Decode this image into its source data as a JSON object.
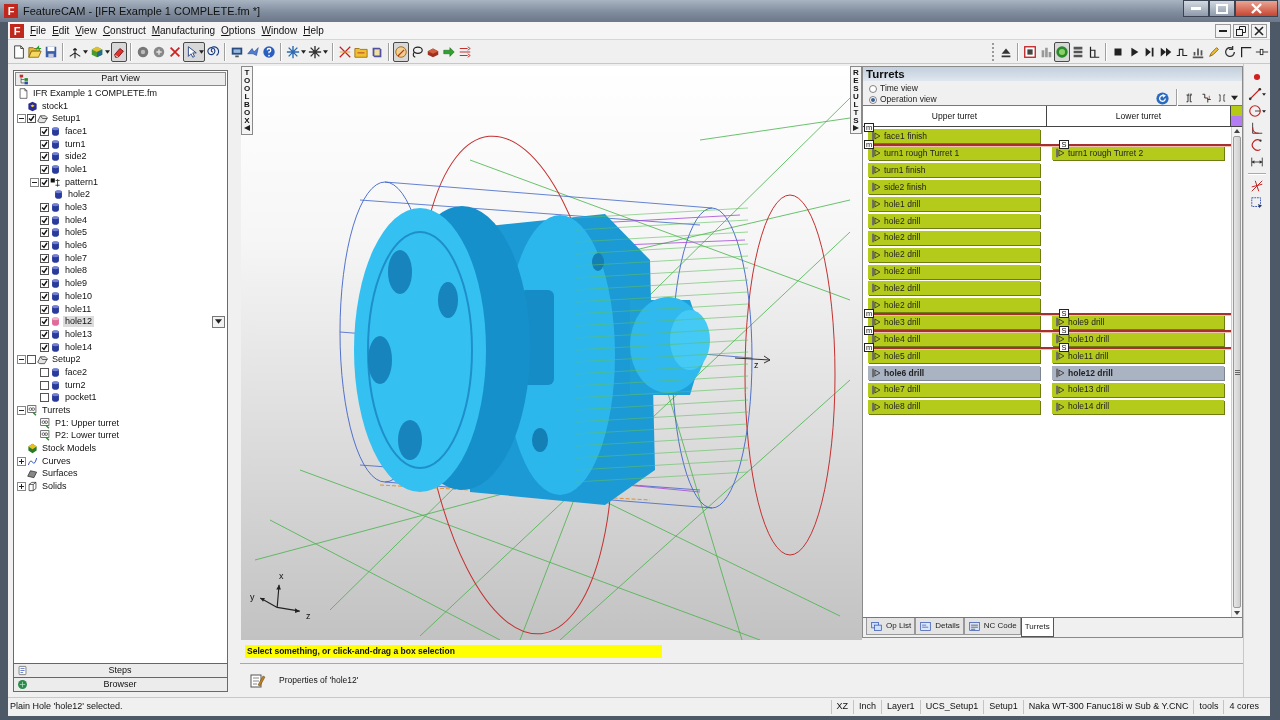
{
  "window": {
    "logo": "F",
    "title": "FeatureCAM - [IFR Example 1 COMPLETE.fm *]"
  },
  "menu_logo": "F",
  "menu": [
    "File",
    "Edit",
    "View",
    "Construct",
    "Manufacturing",
    "Options",
    "Window",
    "Help"
  ],
  "toolbar": {
    "left_groups": [
      [
        {
          "pressed": false
        },
        {
          "pressed": false
        },
        {
          "pressed": false
        }
      ],
      [
        {
          "pressed": false
        },
        {
          "pressed": false
        },
        {
          "pressed": true
        }
      ],
      [
        {
          "pressed": false
        },
        {
          "pressed": false
        },
        {
          "pressed": false
        },
        {
          "pressed": true
        },
        {
          "pressed": false
        }
      ],
      [
        {
          "pressed": false
        },
        {
          "pressed": false
        },
        {
          "pressed": false
        }
      ],
      [
        {
          "pressed": false
        },
        {
          "pressed": false
        }
      ],
      [
        {
          "pressed": false
        },
        {
          "pressed": false
        },
        {
          "pressed": false
        }
      ],
      [
        {
          "pressed": true
        },
        {
          "pressed": false
        },
        {
          "pressed": false
        },
        {
          "pressed": false
        },
        {
          "pressed": false
        }
      ]
    ],
    "right_groups": [
      [
        {
          "pressed": false
        }
      ],
      [
        {
          "pressed": false
        },
        {
          "pressed": false
        },
        {
          "pressed": true
        },
        {
          "pressed": false
        },
        {
          "pressed": false
        }
      ],
      [
        {
          "pressed": false
        },
        {
          "pressed": false
        },
        {
          "pressed": false
        },
        {
          "pressed": false
        },
        {
          "pressed": false
        },
        {
          "pressed": false
        },
        {
          "pressed": false
        },
        {
          "pressed": false
        },
        {
          "pressed": false
        },
        {
          "pressed": false
        }
      ]
    ]
  },
  "part_view": {
    "title": "Part View",
    "tree": [
      {
        "label": "IFR Example 1 COMPLETE.fm",
        "kind": "document",
        "selected": false,
        "children": [
          {
            "label": "stock1",
            "kind": "stock",
            "selected": false
          },
          {
            "label": "Setup1",
            "kind": "setup",
            "checked": true,
            "expanded": true,
            "selected": false,
            "children": [
              {
                "label": "face1",
                "kind": "feature",
                "checked": true,
                "selected": false
              },
              {
                "label": "turn1",
                "kind": "feature",
                "checked": true,
                "selected": false
              },
              {
                "label": "side2",
                "kind": "feature",
                "checked": true,
                "selected": false
              },
              {
                "label": "hole1",
                "kind": "feature",
                "checked": true,
                "selected": false
              },
              {
                "label": "pattern1",
                "kind": "pattern",
                "checked": true,
                "expanded": true,
                "selected": false,
                "children": [
                  {
                    "label": "hole2",
                    "kind": "feature",
                    "selected": false
                  }
                ]
              },
              {
                "label": "hole3",
                "kind": "feature",
                "checked": true,
                "selected": false
              },
              {
                "label": "hole4",
                "kind": "feature",
                "checked": true,
                "selected": false
              },
              {
                "label": "hole5",
                "kind": "feature",
                "checked": true,
                "selected": false
              },
              {
                "label": "hole6",
                "kind": "feature",
                "checked": true,
                "selected": false
              },
              {
                "label": "hole7",
                "kind": "feature",
                "checked": true,
                "selected": false
              },
              {
                "label": "hole8",
                "kind": "feature",
                "checked": true,
                "selected": false
              },
              {
                "label": "hole9",
                "kind": "feature",
                "checked": true,
                "selected": false
              },
              {
                "label": "hole10",
                "kind": "feature",
                "checked": true,
                "selected": false
              },
              {
                "label": "hole11",
                "kind": "feature",
                "checked": true,
                "selected": false
              },
              {
                "label": "hole12",
                "kind": "feature",
                "checked": true,
                "selected": true
              },
              {
                "label": "hole13",
                "kind": "feature",
                "checked": true,
                "selected": false
              },
              {
                "label": "hole14",
                "kind": "feature",
                "checked": true,
                "selected": false
              }
            ]
          },
          {
            "label": "Setup2",
            "kind": "setup",
            "checked": false,
            "expanded": true,
            "selected": false,
            "children": [
              {
                "label": "face2",
                "kind": "feature",
                "checked": false,
                "selected": false
              },
              {
                "label": "turn2",
                "kind": "feature",
                "checked": false,
                "selected": false
              },
              {
                "label": "pocket1",
                "kind": "feature",
                "checked": false,
                "selected": false
              }
            ]
          },
          {
            "label": "Turrets",
            "kind": "turret",
            "expanded": true,
            "selected": false,
            "children": [
              {
                "label": "P1: Upper turret",
                "kind": "turret",
                "selected": false
              },
              {
                "label": "P2: Lower turret",
                "kind": "turret",
                "selected": false
              }
            ]
          },
          {
            "label": "Stock Models",
            "kind": "stock-models",
            "selected": false
          },
          {
            "label": "Curves",
            "kind": "curves",
            "expanded": false,
            "selected": false
          },
          {
            "label": "Surfaces",
            "kind": "surfaces",
            "selected": false
          },
          {
            "label": "Solids",
            "kind": "solids",
            "expanded": false,
            "selected": false
          }
        ]
      }
    ]
  },
  "left_tabs": [
    {
      "label": "Steps"
    },
    {
      "label": "Browser"
    }
  ],
  "toolbox": {
    "label": "TOOLBOX"
  },
  "results": {
    "label": "RESULTS"
  },
  "viewport": {
    "axis_labels": [
      "x",
      "y",
      "z"
    ],
    "part_axis_label": "z"
  },
  "turrets": {
    "title": "Turrets",
    "view_options": [
      {
        "label": "Time view",
        "selected": false
      },
      {
        "label": "Operation view",
        "selected": true
      }
    ],
    "columns": [
      "Upper turret",
      "Lower turret"
    ],
    "swatches": [
      {
        "color": "#b4ca14"
      },
      {
        "color": "#b47cf2"
      }
    ],
    "rows": [
      {
        "upper": {
          "label": "face1 finish",
          "selected": false
        },
        "upper_marker": "m",
        "sync_line": false
      },
      {
        "upper": {
          "label": "turn1 rough Turret 1",
          "selected": false
        },
        "lower": {
          "label": "turn1 rough Turret 2",
          "selected": false
        },
        "upper_marker": "m",
        "lower_marker": "S",
        "sync_line": true
      },
      {
        "upper": {
          "label": "turn1 finish",
          "selected": false
        },
        "sync_line": false
      },
      {
        "upper": {
          "label": "side2 finish",
          "selected": false
        },
        "sync_line": false
      },
      {
        "upper": {
          "label": "hole1 drill",
          "selected": false
        },
        "sync_line": false
      },
      {
        "upper": {
          "label": "hole2 drill",
          "selected": false
        },
        "sync_line": false
      },
      {
        "upper": {
          "label": "hole2 drill",
          "selected": false
        },
        "sync_line": false
      },
      {
        "upper": {
          "label": "hole2 drill",
          "selected": false
        },
        "sync_line": false
      },
      {
        "upper": {
          "label": "hole2 drill",
          "selected": false
        },
        "sync_line": false
      },
      {
        "upper": {
          "label": "hole2 drill",
          "selected": false
        },
        "sync_line": false
      },
      {
        "upper": {
          "label": "hole2 drill",
          "selected": false
        },
        "sync_line": false
      },
      {
        "upper": {
          "label": "hole3 drill",
          "selected": false
        },
        "lower": {
          "label": "hole9 drill",
          "selected": false
        },
        "upper_marker": "m",
        "lower_marker": "S",
        "sync_line": true
      },
      {
        "upper": {
          "label": "hole4 drill",
          "selected": false
        },
        "lower": {
          "label": "hole10 drill",
          "selected": false
        },
        "upper_marker": "m",
        "lower_marker": "S",
        "sync_line": true
      },
      {
        "upper": {
          "label": "hole5 drill",
          "selected": false
        },
        "lower": {
          "label": "hole11 drill",
          "selected": false
        },
        "upper_marker": "m",
        "lower_marker": "S",
        "sync_line": true
      },
      {
        "upper": {
          "label": "hole6 drill",
          "selected": true
        },
        "lower": {
          "label": "hole12 drill",
          "selected": true
        },
        "sync_line": false
      },
      {
        "upper": {
          "label": "hole7 drill",
          "selected": false
        },
        "lower": {
          "label": "hole13 drill",
          "selected": false
        },
        "sync_line": false
      },
      {
        "upper": {
          "label": "hole8 drill",
          "selected": false
        },
        "lower": {
          "label": "hole14 drill",
          "selected": false
        },
        "sync_line": false
      }
    ],
    "tabs": [
      {
        "label": "Op List",
        "selected": false
      },
      {
        "label": "Details",
        "selected": false
      },
      {
        "label": "NC Code",
        "selected": false
      },
      {
        "label": "Turrets",
        "selected": true
      }
    ]
  },
  "message": "Select something, or click-and-drag a box selection",
  "properties": {
    "label": "Properties of 'hole12'"
  },
  "status_bar": {
    "message": "Plain Hole 'hole12' selected.",
    "fields": [
      "XZ",
      "Inch",
      "Layer1",
      "UCS_Setup1",
      "Setup1",
      "Naka WT-300 Fanuc18i w Sub & Y.CNC",
      "tools",
      "4 cores"
    ]
  }
}
